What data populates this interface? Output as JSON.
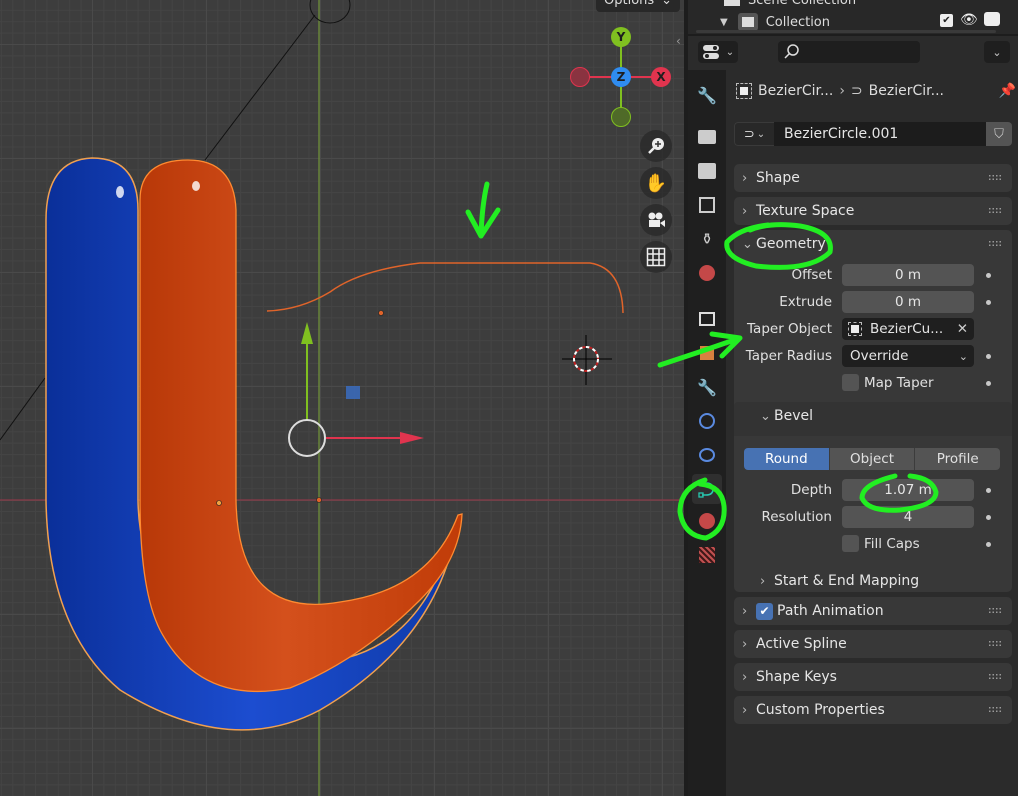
{
  "viewport": {
    "options_label": "Options",
    "gizmo": {
      "y_label": "Y",
      "z_label": "Z",
      "x_label": "X"
    },
    "nav_buttons": [
      "zoom-icon",
      "hand-icon",
      "camera-icon",
      "grid-icon"
    ]
  },
  "outliner": {
    "scene_collection_label": "Scene Collection",
    "collection_label": "Collection"
  },
  "properties": {
    "breadcrumb": {
      "object_name": "BezierCir...",
      "data_name": "BezierCir..."
    },
    "datablock_name": "BezierCircle.001",
    "tabs": [
      "tool-icon",
      "render-icon",
      "output-icon",
      "view-layer-icon",
      "scene-icon",
      "world-icon",
      "collection-icon",
      "object-icon",
      "modifier-icon",
      "particles-icon",
      "physics-icon",
      "curve-data-icon",
      "material-icon",
      "texture-icon"
    ],
    "active_tab": "curve-data-icon",
    "panels": {
      "shape": "Shape",
      "texture_space": "Texture Space",
      "geometry": {
        "title": "Geometry",
        "offset_label": "Offset",
        "offset_value": "0 m",
        "extrude_label": "Extrude",
        "extrude_value": "0 m",
        "taper_object_label": "Taper Object",
        "taper_object_value": "BezierCu...",
        "taper_radius_label": "Taper Radius",
        "taper_radius_value": "Override",
        "map_taper_label": "Map Taper",
        "map_taper_checked": false
      },
      "bevel": {
        "title": "Bevel",
        "modes": [
          "Round",
          "Object",
          "Profile"
        ],
        "active_mode": "Round",
        "depth_label": "Depth",
        "depth_value": "1.07 m",
        "resolution_label": "Resolution",
        "resolution_value": "4",
        "fill_caps_label": "Fill Caps",
        "fill_caps_checked": false
      },
      "start_end_mapping": "Start & End Mapping",
      "path_animation": {
        "title": "Path Animation",
        "checked": true
      },
      "active_spline": "Active Spline",
      "shape_keys": "Shape Keys",
      "custom_properties": "Custom Properties"
    }
  },
  "colors": {
    "accent_blue": "#4772b3",
    "annotation_green": "#22ee22",
    "tube_blue": "#1040c0",
    "tube_orange": "#d04410",
    "axis_x": "#e0344e",
    "axis_y": "#80c020",
    "axis_z": "#2f8cf0"
  }
}
